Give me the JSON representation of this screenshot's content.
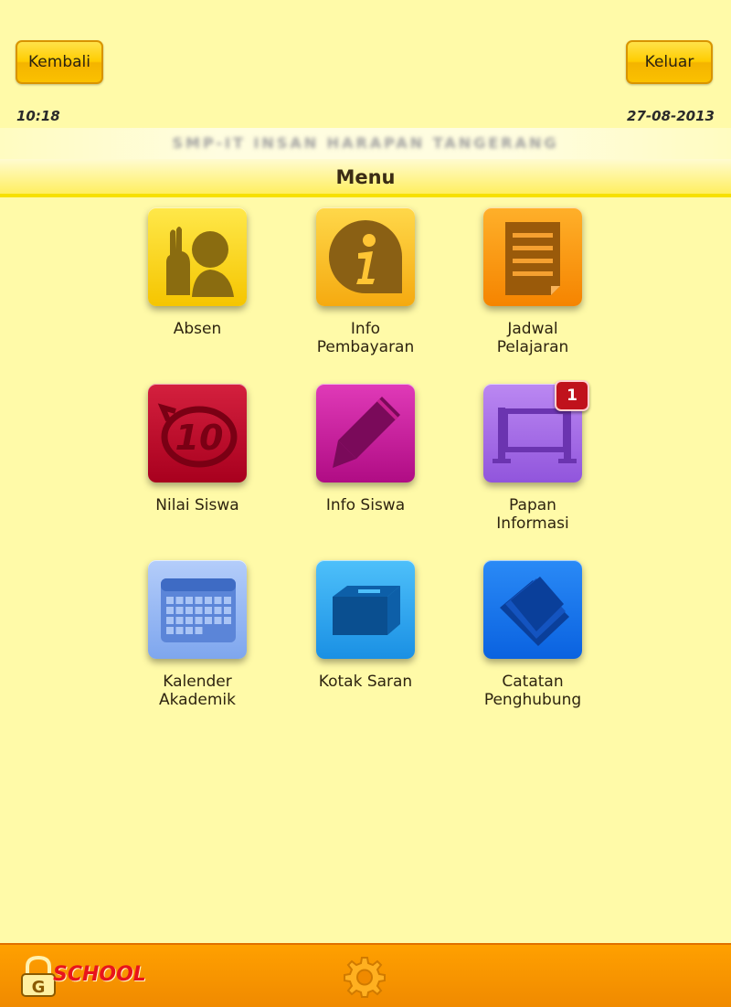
{
  "header": {
    "back_label": "Kembali",
    "logout_label": "Keluar",
    "time": "10:18",
    "date": "27-08-2013",
    "school_name": "SMP-IT INSAN HARAPAN TANGERANG",
    "menu_title": "Menu"
  },
  "menu": {
    "items": [
      {
        "label": "Absen",
        "icon": "raised-hand-icon",
        "color": "#ffd200"
      },
      {
        "label": "Info\nPembayaran",
        "icon": "info-icon",
        "color": "#ffbf1f"
      },
      {
        "label": "Jadwal\nPelajaran",
        "icon": "schedule-document-icon",
        "color": "#ff9a00"
      },
      {
        "label": "Nilai Siswa",
        "icon": "grade-stamp-icon",
        "color": "#c4112e"
      },
      {
        "label": "Info Siswa",
        "icon": "pencil-icon",
        "color": "#cc1a98"
      },
      {
        "label": "Papan\nInformasi",
        "icon": "board-icon",
        "color": "#a56ae6",
        "badge": "1"
      },
      {
        "label": "Kalender\nAkademik",
        "icon": "calendar-icon",
        "color": "#8fb5f5"
      },
      {
        "label": "Kotak Saran",
        "icon": "suggestion-box-icon",
        "color": "#2ca6f0"
      },
      {
        "label": "Catatan\nPenghubung",
        "icon": "notes-icon",
        "color": "#1a7af0"
      }
    ]
  },
  "footer": {
    "logo_text": "SCHOOL",
    "logo_icon": "school-lock-logo",
    "settings_icon": "gear-icon"
  }
}
